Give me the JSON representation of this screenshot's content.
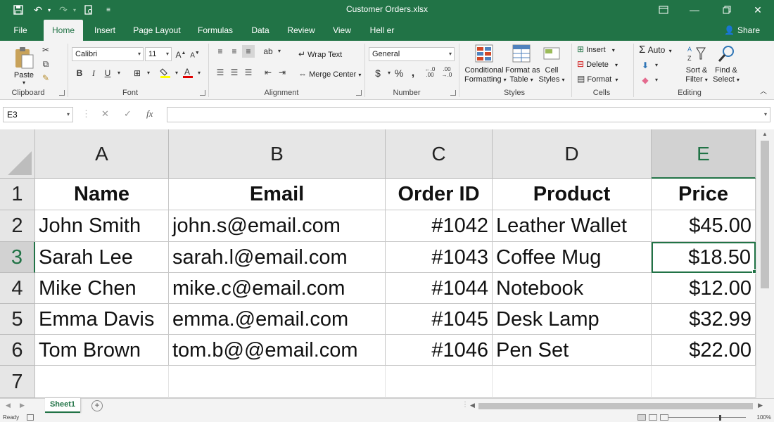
{
  "window": {
    "title": "Customer Orders.xlsx"
  },
  "quick_access": {
    "save_icon": "save-icon",
    "undo_icon": "undo-icon",
    "redo_icon": "redo-icon",
    "print_preview_icon": "print-preview-icon",
    "customize_icon": "customize-qat-icon"
  },
  "ribbon_tabs": [
    "File",
    "Home",
    "Insert",
    "Page Layout",
    "Formulas",
    "Data",
    "Review",
    "View",
    "Hell er"
  ],
  "share_label": "Share",
  "ribbon": {
    "clipboard": {
      "paste": "Paste",
      "group": "Clipboard"
    },
    "font": {
      "name": "Calibri",
      "size": "11",
      "group": "Font"
    },
    "alignment": {
      "wrap_text": "Wrap Text",
      "merge_center": "Merge Center",
      "group": "Alignment"
    },
    "number": {
      "format": "General",
      "currency": "$",
      "percent": "%",
      "comma": ",",
      "group": "Number"
    },
    "styles": {
      "conditional": "Conditional",
      "formatting": "Formatting",
      "format_as": "Format as",
      "table": "Table",
      "cell": "Cell",
      "cell_styles": "Styles",
      "group": "Styles"
    },
    "cells": {
      "insert": "Insert",
      "delete": "Delete",
      "format": "Format",
      "group": "Cells"
    },
    "editing": {
      "autosum": "Auto",
      "sort": "Sort &",
      "filter": "Filter",
      "find": "Find &",
      "select": "Select",
      "group": "Editing"
    }
  },
  "formula_bar": {
    "name_box": "E3",
    "cancel": "✕",
    "enter": "✓",
    "fx": "fx",
    "value": ""
  },
  "grid": {
    "columns": [
      "A",
      "B",
      "C",
      "D",
      "E"
    ],
    "rows": [
      "1",
      "2",
      "3",
      "4",
      "5",
      "6",
      "7"
    ],
    "selected_column": "E",
    "selected_row": "3",
    "header_row": [
      "Name",
      "Email",
      "Order ID",
      "Product",
      "Price"
    ],
    "data": [
      [
        "John Smith",
        "john.s@email.com",
        "#1042",
        "Leather Wallet",
        "$45.00"
      ],
      [
        "Sarah Lee",
        "sarah.l@email.com",
        "#1043",
        "Coffee Mug",
        "$18.50"
      ],
      [
        "Mike Chen",
        "mike.c@email.com",
        "#1044",
        "Notebook",
        "$12.00"
      ],
      [
        "Emma Davis",
        "emma.@email.com",
        "#1045",
        "Desk Lamp",
        "$32.99"
      ],
      [
        "Tom Brown",
        "tom.b@@email.com",
        "#1046",
        "Pen Set",
        "$22.00"
      ]
    ]
  },
  "sheet_tabs": [
    "Sheet1"
  ],
  "status": {
    "ready": "Ready",
    "zoom": "100%"
  }
}
